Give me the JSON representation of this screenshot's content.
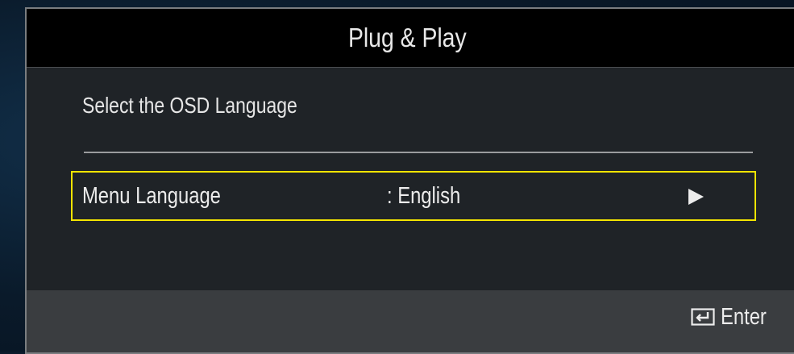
{
  "dialog": {
    "title": "Plug & Play",
    "subtitle": "Select the OSD Language"
  },
  "setting": {
    "label": "Menu Language",
    "value": ": English"
  },
  "footer": {
    "enter_label": "Enter",
    "enter_icon": "enter-key-icon"
  },
  "colors": {
    "highlight": "#f3e400",
    "title_bg": "#000000",
    "panel_bg": "#1f2327",
    "footer_bg": "#3a3d40"
  }
}
